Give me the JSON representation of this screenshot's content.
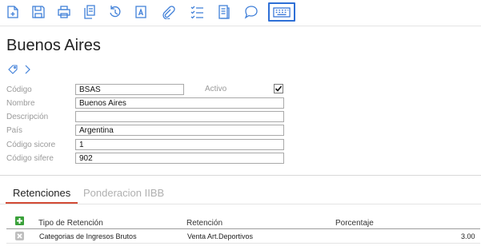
{
  "toolbar": {
    "icons": [
      "new-icon",
      "save-icon",
      "print-icon",
      "copy-icon",
      "history-icon",
      "text-icon",
      "attach-icon",
      "list-icon",
      "report-icon",
      "comment-icon",
      "keyboard-icon"
    ],
    "accent": "#2e6fd6",
    "icon_color": "#3f7fd8"
  },
  "header": {
    "title": "Buenos Aires"
  },
  "form": {
    "codigo_label": "Código",
    "codigo_value": "BSAS",
    "activo_label": "Activo",
    "activo_checked": true,
    "nombre_label": "Nombre",
    "nombre_value": "Buenos Aires",
    "descripcion_label": "Descripción",
    "descripcion_value": "",
    "pais_label": "País",
    "pais_value": "Argentina",
    "codigo_sicore_label": "Código sicore",
    "codigo_sicore_value": "1",
    "codigo_sifere_label": "Código sifere",
    "codigo_sifere_value": "902"
  },
  "tabs": [
    {
      "label": "Retenciones",
      "active": true
    },
    {
      "label": "Ponderacion IIBB",
      "active": false
    }
  ],
  "table": {
    "headers": [
      "Tipo de Retención",
      "Retención",
      "Porcentaje"
    ],
    "rows": [
      {
        "tipo": "Categorias de Ingresos Brutos",
        "retencion": "Venta Art.Deportivos",
        "porcentaje": "3.00"
      }
    ]
  },
  "colors": {
    "tab_underline": "#d24a35",
    "add_green": "#3aa13a"
  }
}
